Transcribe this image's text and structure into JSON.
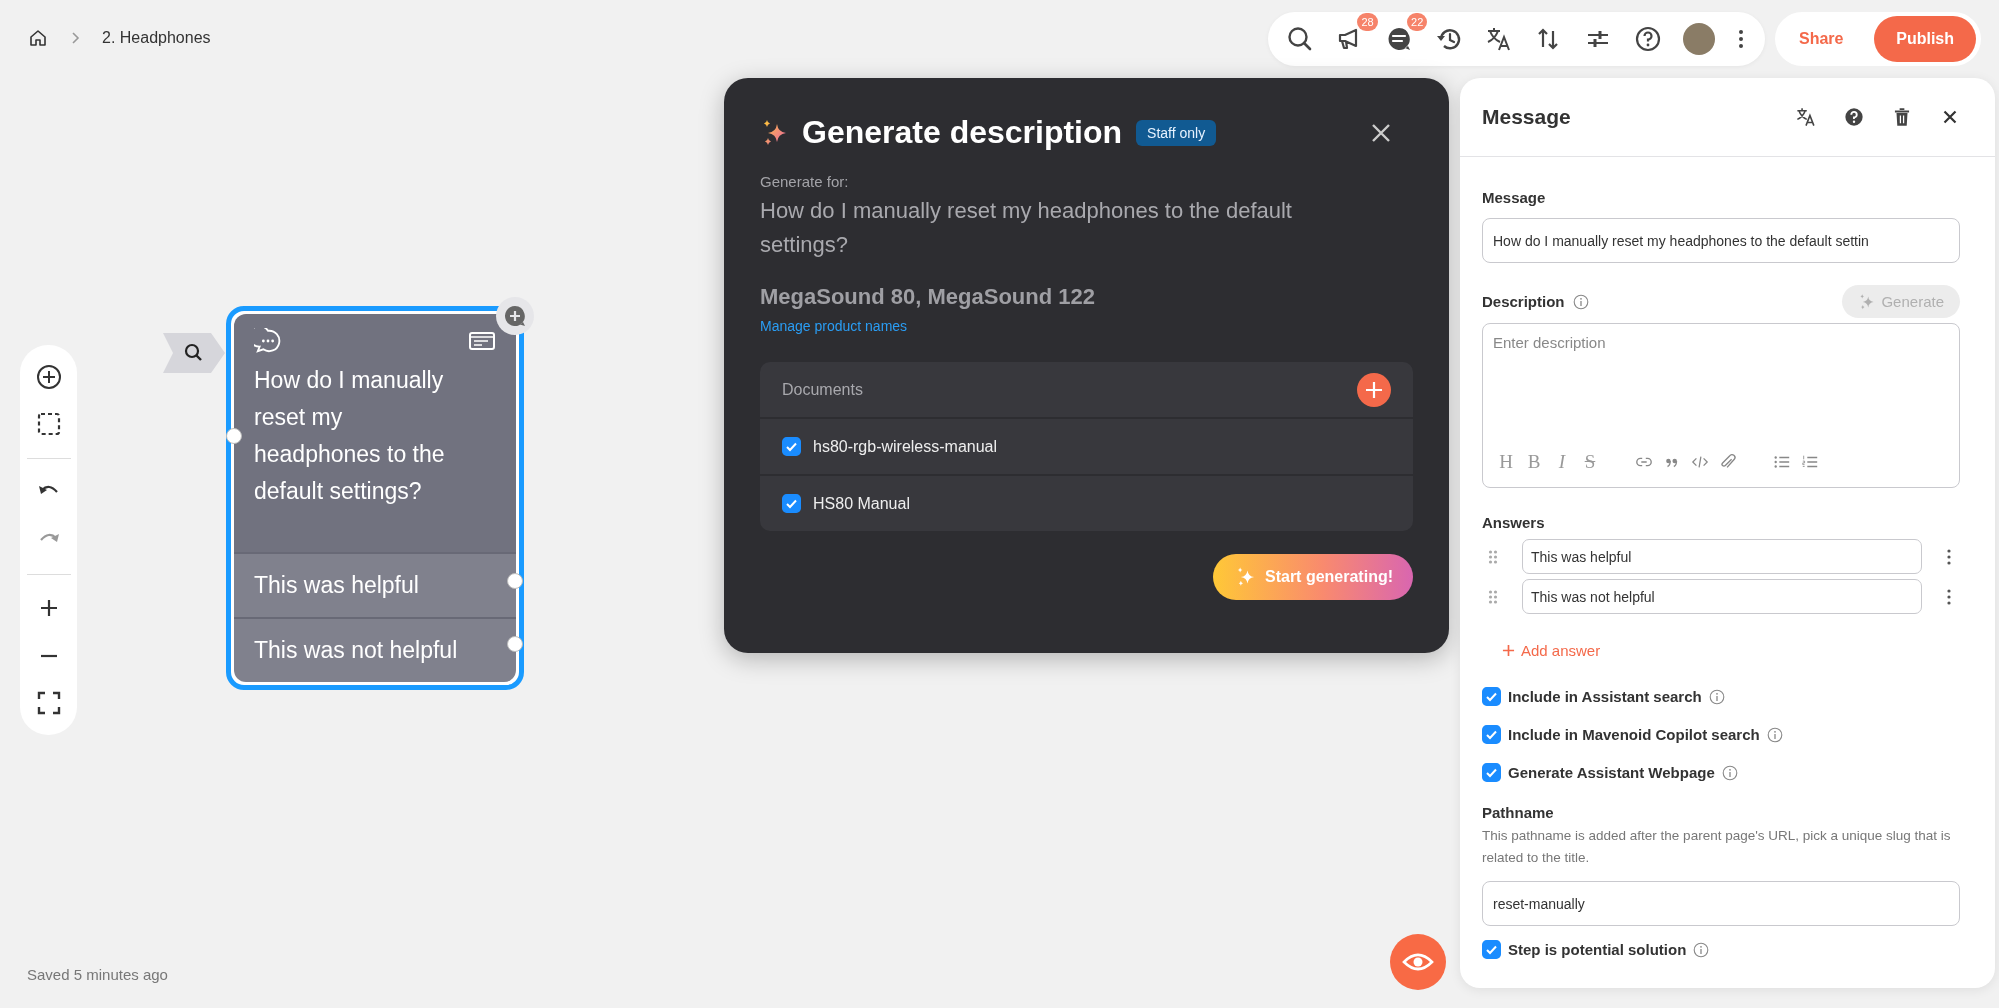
{
  "breadcrumb": {
    "current": "2. Headphones"
  },
  "toolbar": {
    "announcements_badge": "28",
    "comments_badge": "22"
  },
  "header_actions": {
    "share": "Share",
    "publish": "Publish"
  },
  "canvas": {
    "node": {
      "selected": true,
      "title": "How do I manually reset my headphones to the default settings?",
      "answers": [
        "This was helpful",
        "This was not helpful"
      ]
    }
  },
  "saved_status": "Saved 5 minutes ago",
  "modal": {
    "title": "Generate description",
    "badge": "Staff only",
    "generate_for_label": "Generate for:",
    "question": "How do I manually reset my headphones to the default settings?",
    "products": "MegaSound 80, MegaSound 122",
    "manage_link": "Manage product names",
    "documents": {
      "title": "Documents",
      "items": [
        {
          "label": "hs80-rgb-wireless-manual",
          "checked": true
        },
        {
          "label": "HS80 Manual",
          "checked": true
        }
      ]
    },
    "start_button": "Start generating!"
  },
  "panel": {
    "title": "Message",
    "message_label": "Message",
    "message_value": "How do I manually reset my headphones to the default settin",
    "description_label": "Description",
    "generate_button": {
      "label": "Generate",
      "disabled": true
    },
    "description_placeholder": "Enter description",
    "format_letters": [
      "H",
      "B",
      "I",
      "S"
    ],
    "answers_label": "Answers",
    "answers": [
      "This was helpful",
      "This was not helpful"
    ],
    "add_answer": "Add answer",
    "options": [
      {
        "label": "Include in Assistant search",
        "checked": true
      },
      {
        "label": "Include in Mavenoid Copilot search",
        "checked": true
      },
      {
        "label": "Generate Assistant Webpage",
        "checked": true
      }
    ],
    "pathname_label": "Pathname",
    "pathname_help": "This pathname is added after the parent page's URL, pick a unique slug that is related to the title.",
    "pathname_value": "reset-manually",
    "potential_solution": {
      "label": "Step is potential solution",
      "checked": true
    }
  }
}
